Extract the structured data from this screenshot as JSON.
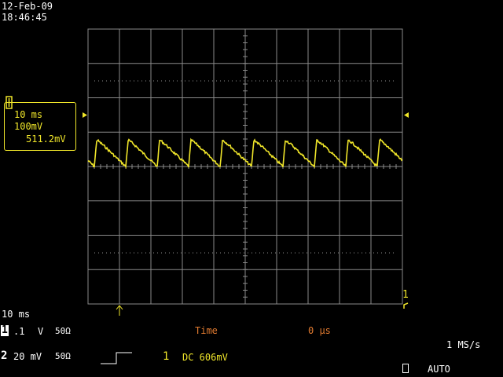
{
  "header": {
    "date": "12-Feb-09",
    "time": "18:46:45"
  },
  "channel_panel": {
    "timebase": "10 ms",
    "volts_per_div": "100mV",
    "offset": "511.2mV"
  },
  "bottom": {
    "timebase_label": "10 ms",
    "ch1": {
      "number": "1",
      "volts": ".1",
      "unit": "V",
      "impedance": "50Ω"
    },
    "ch2": {
      "number": "2",
      "volts": "20 mV",
      "impedance": "50Ω"
    },
    "time_label": "Time",
    "time_value": "0 µs",
    "trigger_source": "1",
    "trigger_level": "DC 606mV",
    "sample_rate": "1 MS/s",
    "trigger_mode": "AUTO"
  },
  "markers": {
    "trace_number": "1"
  },
  "colors": {
    "trace": "#f0e62a",
    "grid": "#8a8a8a",
    "time_text": "#e07a30"
  }
}
